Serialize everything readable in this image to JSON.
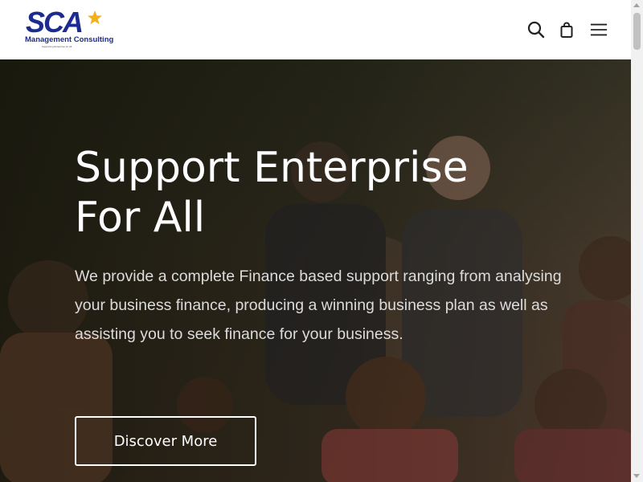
{
  "header": {
    "logo": {
      "letters": "SCA",
      "subtitle": "Management Consulting",
      "tagline": "Supporting Enterprise for All"
    },
    "icons": [
      "search-icon",
      "shopping-bag-icon",
      "menu-icon"
    ]
  },
  "hero": {
    "title_line1": "Support Enterprise",
    "title_line2": "For All",
    "description": "We provide a complete Finance based support ranging from analysing your business finance, producing a winning business plan as well as assisting you to seek finance for your business.",
    "cta_label": "Discover More"
  },
  "colors": {
    "brand_blue": "#1b2b8f",
    "brand_gold": "#f2b01e",
    "hero_text": "#ffffff",
    "hero_body": "#dcdcdc"
  }
}
